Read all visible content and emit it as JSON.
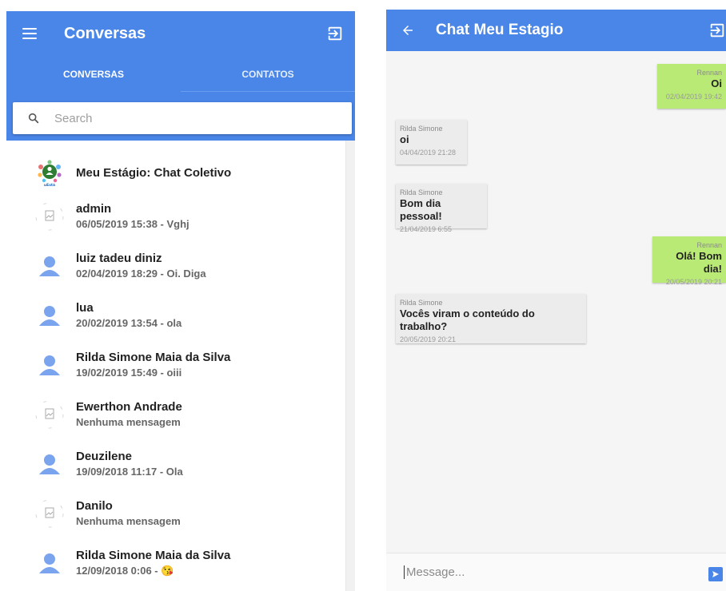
{
  "left": {
    "title": "Conversas",
    "tabs": [
      {
        "label": "CONVERSAS",
        "active": true
      },
      {
        "label": "CONTATOS",
        "active": false
      }
    ],
    "search": {
      "placeholder": "Search",
      "value": ""
    },
    "conversations": [
      {
        "name": "Meu Estágio: Chat Coletivo",
        "subtitle": "",
        "avatar": "group-logo"
      },
      {
        "name": "admin",
        "subtitle": "06/05/2019 15:38 - Vghj",
        "avatar": "broken-image"
      },
      {
        "name": "luiz tadeu diniz",
        "subtitle": "02/04/2019 18:29 - Oi. Diga",
        "avatar": "person"
      },
      {
        "name": "lua",
        "subtitle": "20/02/2019 13:54 - ola",
        "avatar": "person"
      },
      {
        "name": "Rilda Simone Maia da Silva",
        "subtitle": "19/02/2019 15:49 - oiii",
        "avatar": "person"
      },
      {
        "name": "Ewerthon Andrade",
        "subtitle": "Nenhuma mensagem",
        "avatar": "broken-image"
      },
      {
        "name": "Deuzilene",
        "subtitle": "19/09/2018 11:17 - Ola",
        "avatar": "person"
      },
      {
        "name": "Danilo",
        "subtitle": "Nenhuma mensagem",
        "avatar": "broken-image"
      },
      {
        "name": "Rilda Simone Maia da Silva",
        "subtitle": "12/09/2018 0:06 - 😘",
        "avatar": "person"
      }
    ]
  },
  "chat": {
    "title": "Chat Meu Estagio",
    "messages": [
      {
        "author": "Rennan",
        "text": "Oi",
        "time": "02/04/2019 19:42",
        "mine": true
      },
      {
        "author": "Rilda Simone",
        "text": "oi",
        "time": "04/04/2019 21:28",
        "mine": false
      },
      {
        "author": "Rilda Simone",
        "text": "Bom dia pessoal!",
        "time": "21/04/2019 6:55",
        "mine": false
      },
      {
        "author": "Rennan",
        "text": "Olá! Bom dia!",
        "time": "20/05/2019 20:21",
        "mine": true
      },
      {
        "author": "Rilda Simone",
        "text": "Vocês viram o conteúdo do trabalho?",
        "time": "20/05/2019 20:21",
        "mine": false
      }
    ],
    "composer": {
      "placeholder": "Message...",
      "value": ""
    }
  },
  "colors": {
    "primary": "#4a86e8",
    "my_bubble": "#b9ea75",
    "other_bubble": "#ececec",
    "person_icon": "#7ba4ee"
  },
  "icons": [
    "menu-icon",
    "exit-icon",
    "search-icon",
    "back-arrow-icon",
    "send-icon",
    "person-icon",
    "broken-image-icon",
    "group-logo-icon"
  ]
}
